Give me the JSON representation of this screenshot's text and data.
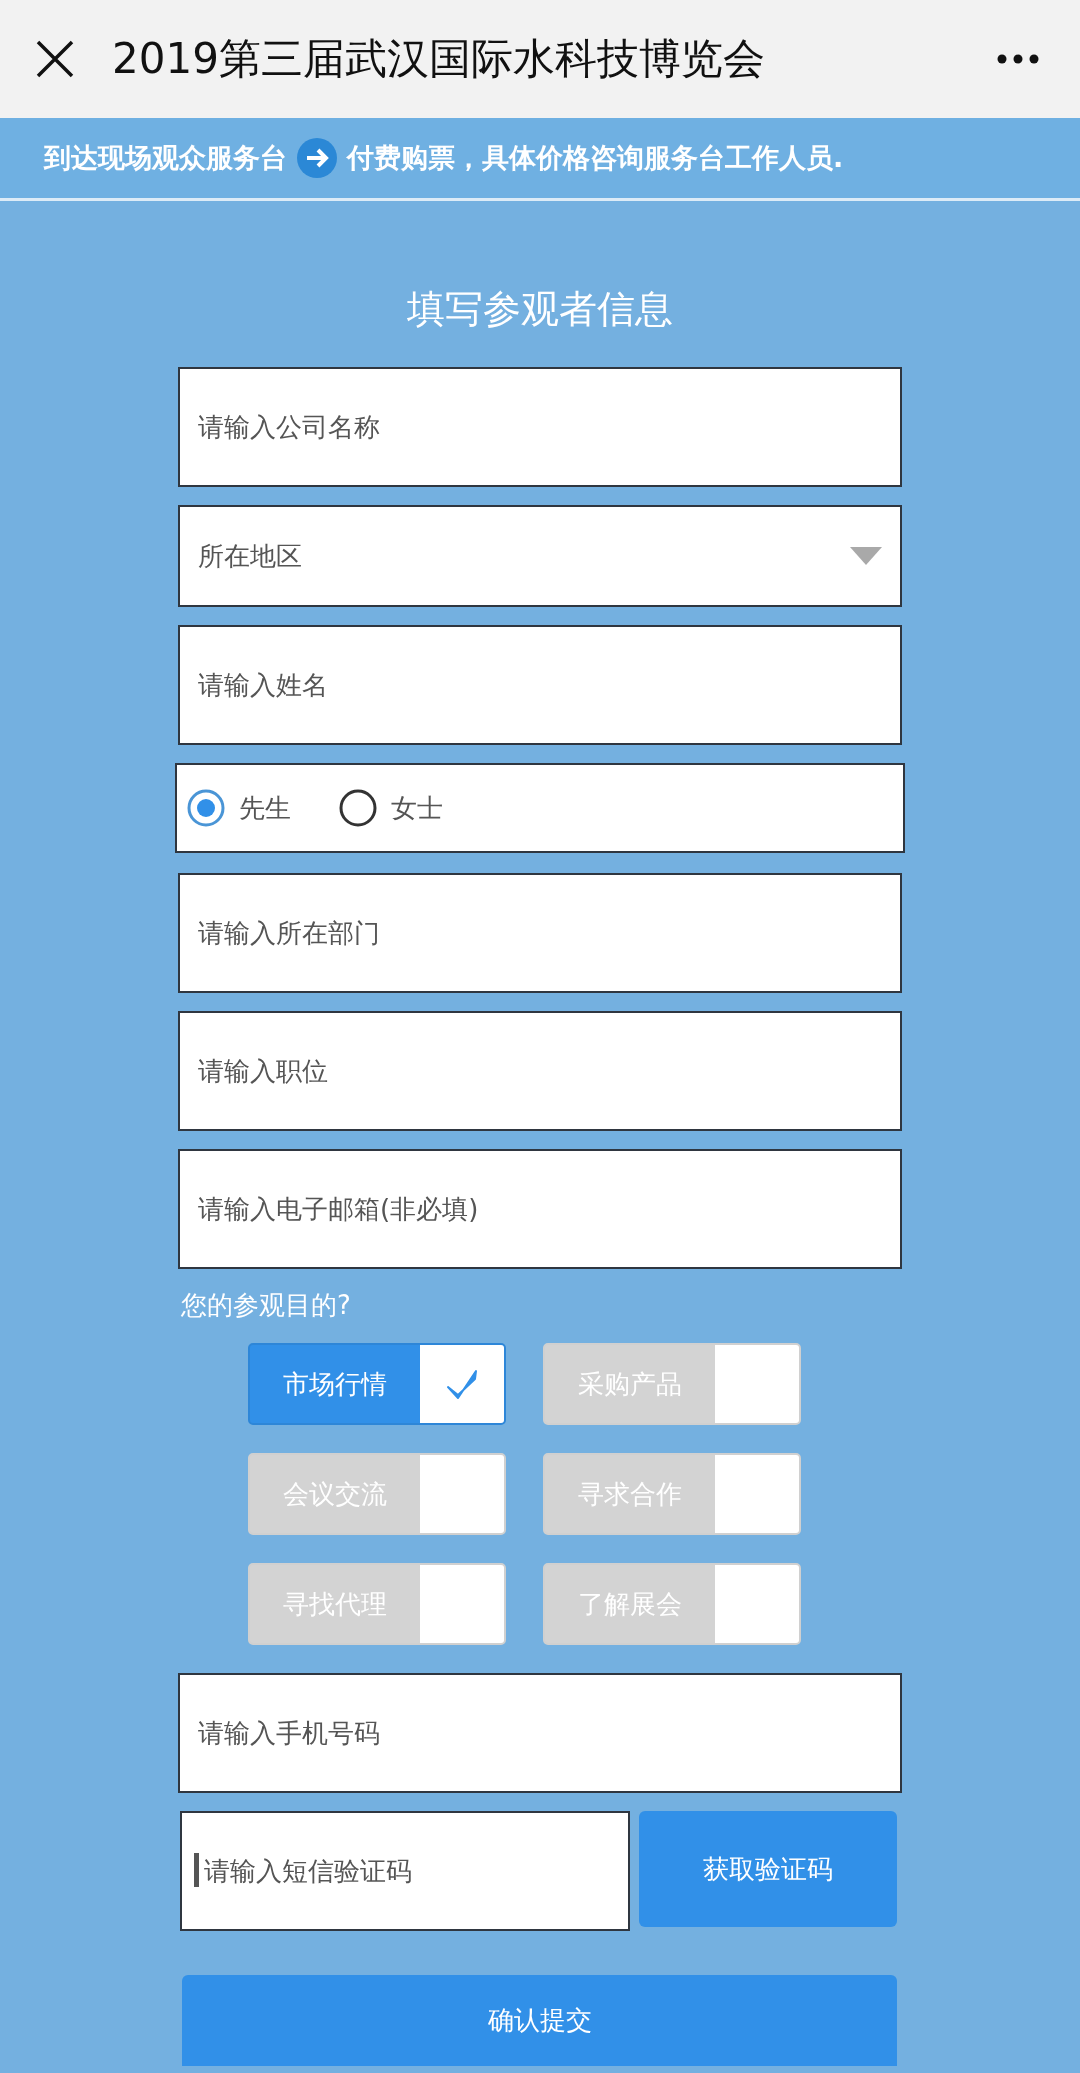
{
  "header": {
    "title": "2019第三届武汉国际水科技博览会"
  },
  "notice": {
    "before": "到达现场观众服务台",
    "after": "付费购票，具体价格咨询服务台工作人员."
  },
  "form": {
    "heading": "填写参观者信息",
    "fields": [
      {
        "kind": "text",
        "placeholder": "请输入公司名称"
      },
      {
        "kind": "select",
        "placeholder": "所在地区"
      },
      {
        "kind": "text",
        "placeholder": "请输入姓名"
      },
      {
        "kind": "radio",
        "options": [
          {
            "label": "先生",
            "selected": true
          },
          {
            "label": "女士",
            "selected": false
          }
        ]
      },
      {
        "kind": "text",
        "placeholder": "请输入所在部门"
      },
      {
        "kind": "text",
        "placeholder": "请输入职位"
      },
      {
        "kind": "text",
        "placeholder": "请输入电子邮箱(非必填)"
      }
    ],
    "purpose": {
      "question": "您的参观目的?",
      "options": [
        {
          "label": "市场行情",
          "checked": true
        },
        {
          "label": "采购产品",
          "checked": false
        },
        {
          "label": "会议交流",
          "checked": false
        },
        {
          "label": "寻求合作",
          "checked": false
        },
        {
          "label": "寻找代理",
          "checked": false
        },
        {
          "label": "了解展会",
          "checked": false
        }
      ]
    },
    "phone": {
      "placeholder": "请输入手机号码"
    },
    "sms": {
      "placeholder": "请输入短信验证码",
      "focused": true,
      "button": "获取验证码"
    },
    "submit": "确认提交"
  }
}
